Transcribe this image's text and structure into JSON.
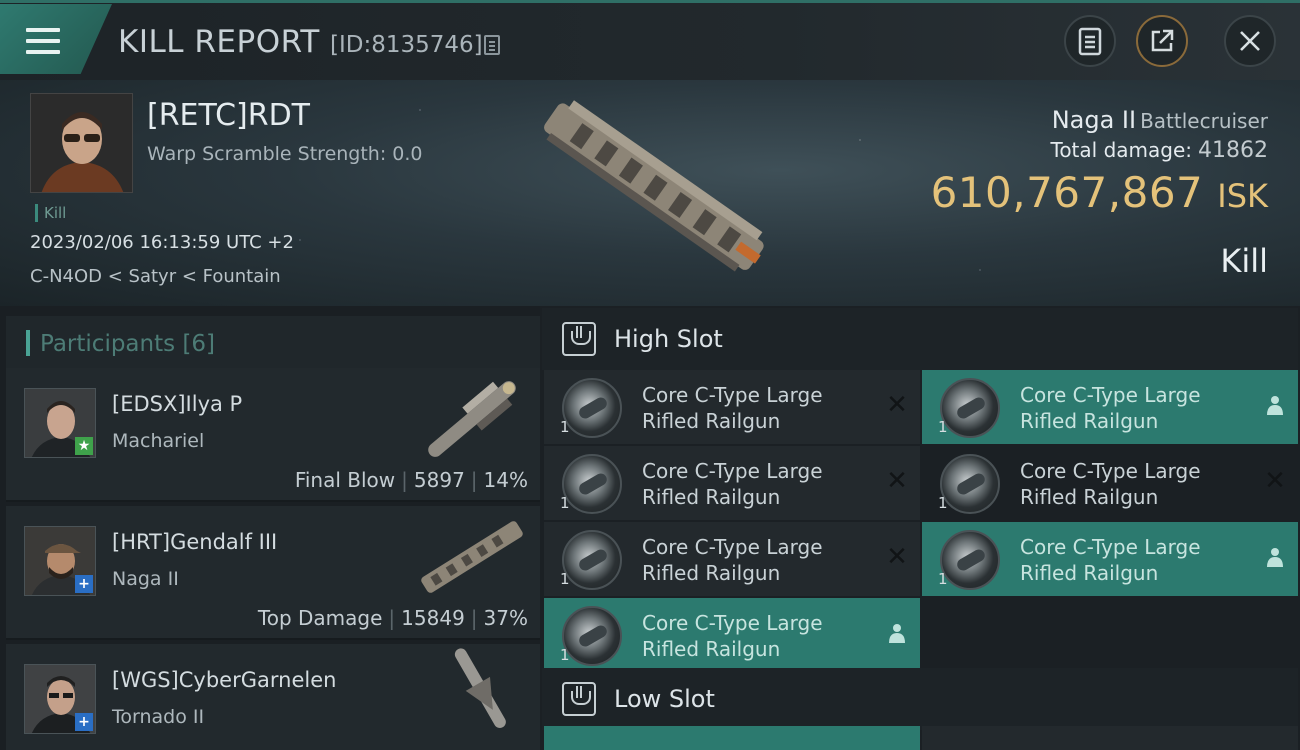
{
  "header": {
    "title": "KILL REPORT",
    "id_text": "[ID:8135746]"
  },
  "victim": {
    "name": "[RETC]RDT",
    "warp_scramble": "Warp Scramble Strength: 0.0",
    "tag": "Kill",
    "time": "2023/02/06 16:13:59 UTC +2",
    "location": "C-N4OD < Satyr < Fountain",
    "ship_name": "Naga II",
    "ship_class": "Battlecruiser",
    "total_damage_label": "Total damage:",
    "total_damage_value": "41862",
    "isk_value": "610,767,867",
    "isk_unit": "ISK",
    "result": "Kill"
  },
  "participants": {
    "title": "Participants [6]",
    "items": [
      {
        "name": "[EDSX]Ilya P",
        "ship": "Macharie​l",
        "role": "Final Blow",
        "damage": "5897",
        "percent": "14%",
        "badge": "star"
      },
      {
        "name": "[HRT]Gendalf III",
        "ship": "Naga II",
        "role": "Top Damage",
        "damage": "15849",
        "percent": "37%",
        "badge": "plus"
      },
      {
        "name": "[WGS]CyberGarnelen",
        "ship": "Tornado II",
        "role": "",
        "damage": "",
        "percent": "",
        "badge": "plus"
      }
    ]
  },
  "fitting": {
    "high_slot_title": "High Slot",
    "low_slot_title": "Low Slot",
    "modules": [
      {
        "line1": "Core C-Type Large",
        "line2": "Rifled Railgun",
        "qty": "1",
        "status": "destroyed"
      },
      {
        "line1": "Core C-Type Large",
        "line2": "Rifled Railgun",
        "qty": "1",
        "status": "dropped"
      },
      {
        "line1": "Core C-Type Large",
        "line2": "Rifled Railgun",
        "qty": "1",
        "status": "destroyed"
      },
      {
        "line1": "Core C-Type Large",
        "line2": "Rifled Railgun",
        "qty": "1",
        "status": "destroyed"
      },
      {
        "line1": "Core C-Type Large",
        "line2": "Rifled Railgun",
        "qty": "1",
        "status": "destroyed"
      },
      {
        "line1": "Core C-Type Large",
        "line2": "Rifled Railgun",
        "qty": "1",
        "status": "dropped"
      },
      {
        "line1": "Core C-Type Large",
        "line2": "Rifled Railgun",
        "qty": "1",
        "status": "dropped"
      }
    ]
  },
  "icons": {
    "menu": "hamburger-icon",
    "copy": "copy-icon",
    "report": "clipboard-icon",
    "share": "share-icon",
    "close": "close-icon",
    "destroyed": "x-icon",
    "dropped": "person-icon"
  },
  "colors": {
    "accent": "#2f7a70",
    "isk": "#e4c27a",
    "dropped": "#2c7a6f"
  }
}
